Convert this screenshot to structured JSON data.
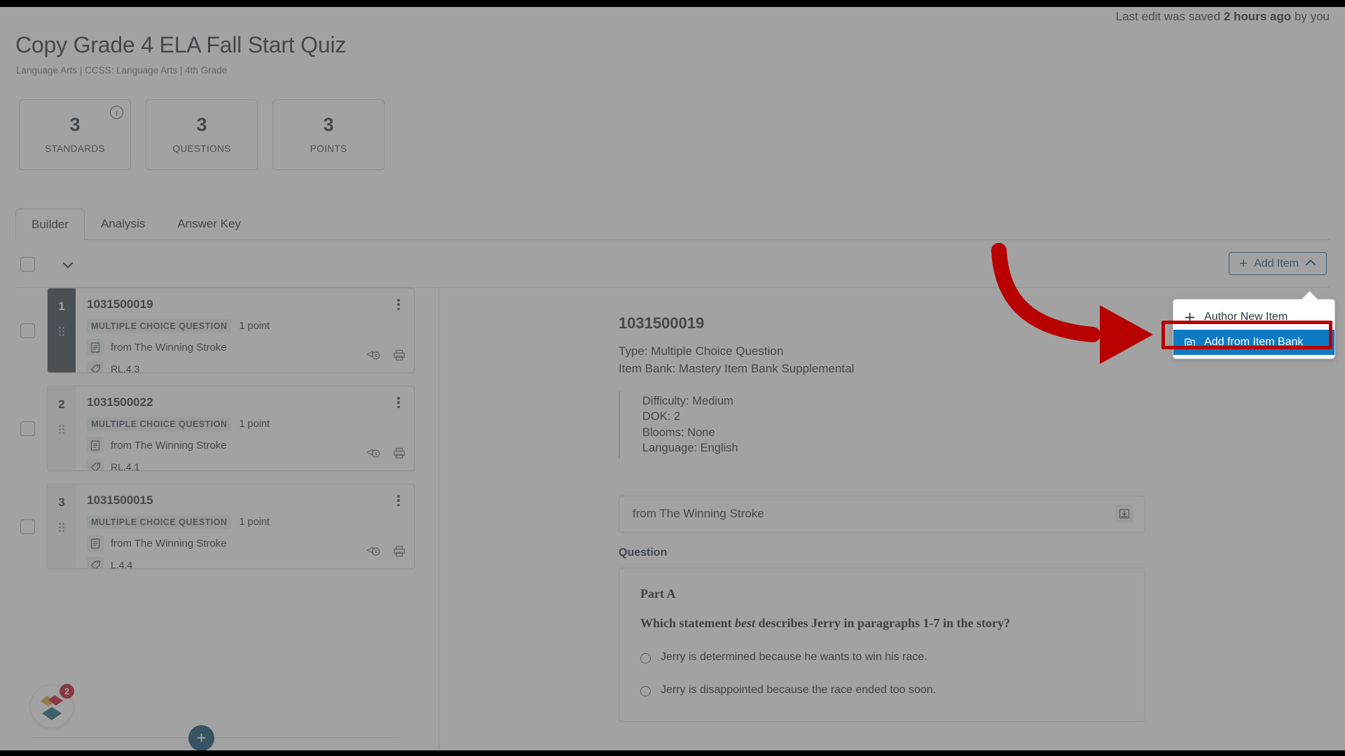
{
  "header": {
    "saved_prefix": "Last edit was saved",
    "saved_time": "2 hours ago",
    "saved_suffix": "by you",
    "title": "Copy Grade 4 ELA Fall Start Quiz",
    "subtitle": "Language Arts  |  CCSS: Language Arts  |  4th Grade"
  },
  "stats": [
    {
      "value": "3",
      "label": "STANDARDS",
      "has_info_icon": true
    },
    {
      "value": "3",
      "label": "QUESTIONS",
      "has_info_icon": false
    },
    {
      "value": "3",
      "label": "POINTS",
      "has_info_icon": false
    }
  ],
  "tabs": [
    {
      "label": "Builder",
      "active": true
    },
    {
      "label": "Analysis",
      "active": false
    },
    {
      "label": "Answer Key",
      "active": false
    }
  ],
  "toolbar": {
    "add_item_label": "Add Item",
    "add_item_plus": "+",
    "chevron_icon": "chevron-up-icon",
    "select_all_checkbox": "",
    "expand_chevron_icon": "chevron-down-icon"
  },
  "dropdown": {
    "items": [
      {
        "label": "Author New Item",
        "icon": "plus-icon",
        "selected": false
      },
      {
        "label": "Add from Item Bank",
        "icon": "item-bank-icon",
        "selected": true
      }
    ]
  },
  "annotation": {
    "color": "#b80000",
    "shape": "curved-arrow-pointing-right"
  },
  "items": [
    {
      "number": "1",
      "id": "1031500019",
      "type_badge": "MULTIPLE CHOICE QUESTION",
      "points": "1 point",
      "source": "from The Winning Stroke",
      "standard": "RL.4.3",
      "selected": true
    },
    {
      "number": "2",
      "id": "1031500022",
      "type_badge": "MULTIPLE CHOICE QUESTION",
      "points": "1 point",
      "source": "from The Winning Stroke",
      "standard": "RL.4.1",
      "selected": false
    },
    {
      "number": "3",
      "id": "1031500015",
      "type_badge": "MULTIPLE CHOICE QUESTION",
      "points": "1 point",
      "source": "from The Winning Stroke",
      "standard": "L.4.4",
      "selected": false
    }
  ],
  "list_footer": {
    "add_button_label": "+",
    "helper_badge_count": "2"
  },
  "detail": {
    "id": "1031500019",
    "type_line": "Type: Multiple Choice Question",
    "bank_line": "Item Bank: Mastery Item Bank Supplemental",
    "attributes": [
      "Difficulty: Medium",
      "DOK: 2",
      "Blooms: None",
      "Language: English"
    ],
    "passage_title": "from The Winning Stroke",
    "passage_collapse_icon": "collapse-down-icon",
    "question_label": "Question",
    "part_label": "Part A",
    "stem_before": "Which statement ",
    "stem_emphasis": "best",
    "stem_after": " describes Jerry in paragraphs 1-7 in the story?",
    "options": [
      "Jerry is determined because he wants to win his race.",
      "Jerry is disappointed because the race ended too soon."
    ]
  },
  "colors": {
    "accent_blue": "#0f7ac4",
    "link_blue": "#1b5d85",
    "annotation_red": "#b80000",
    "rail_dark": "#3a4450",
    "fab_teal": "#0e4f72",
    "badge_red": "#c8102e"
  }
}
